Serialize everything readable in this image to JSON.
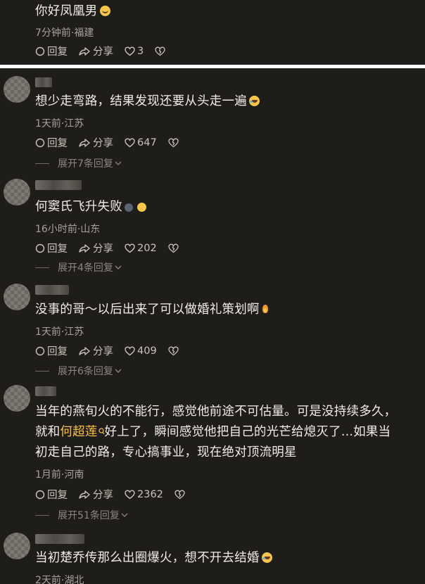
{
  "top_comment": {
    "text": "你好凤凰男",
    "time_location": "7分钟前·福建",
    "reply": "回复",
    "share": "分享",
    "likes": "3"
  },
  "comments": [
    {
      "text": "想少走弯路，结果发现还要从头走一遍",
      "time_location": "1天前·江苏",
      "reply": "回复",
      "share": "分享",
      "likes": "647",
      "expand": "展开7条回复"
    },
    {
      "text": "何窦氏飞升失败",
      "time_location": "16小时前·山东",
      "reply": "回复",
      "share": "分享",
      "likes": "202",
      "expand": "展开4条回复"
    },
    {
      "text": "没事的哥～以后出来了可以做婚礼策划啊",
      "time_location": "1天前·江苏",
      "reply": "回复",
      "share": "分享",
      "likes": "409",
      "expand": "展开6条回复"
    },
    {
      "text_line1": "当年的燕旬火的不能行，感觉他前途不可估量。可是没持续多久，",
      "text_line2_before": "就和",
      "text_line2_link": "何超莲",
      "text_line2_after": "好上了，瞬间感觉他把自己的光芒给熄灭了...如果当",
      "text_line3": "初走自己的路，专心搞事业，现在绝对顶流明星",
      "time_location": "1月前·河南",
      "reply": "回复",
      "share": "分享",
      "likes": "2362",
      "expand": "展开51条回复"
    },
    {
      "text": "当初楚乔传那么出圈爆火，想不开去结婚",
      "time_location": "2天前·湖北"
    }
  ],
  "colors": {
    "background": "#1f1d19",
    "link": "#f6c347",
    "meta": "#a7a29b"
  }
}
